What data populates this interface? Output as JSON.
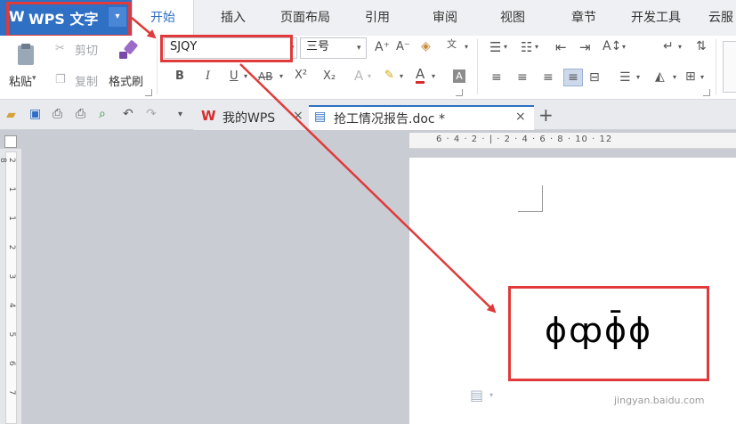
{
  "app": {
    "logo": "W",
    "title": "WPS 文字",
    "dropdown": "▾"
  },
  "tabs": [
    "开始",
    "插入",
    "页面布局",
    "引用",
    "审阅",
    "视图",
    "章节",
    "开发工具",
    "云服"
  ],
  "clipboard": {
    "paste": "粘贴",
    "cut": "剪切",
    "copy": "复制",
    "format_painter": "格式刷"
  },
  "font": {
    "name": "SJQY",
    "size": "三号"
  },
  "doc_tabs": [
    {
      "label": "我的WPS",
      "close": "×"
    },
    {
      "label": "抢工情况报告.doc *",
      "close": "×"
    }
  ],
  "new_tab": "+",
  "ruler_top_text": "6 · 4 · 2 · | · 2 · 4 · 6 · 8 · 10 · 12",
  "ruler_left_text": "2 1 1 2 3 4 5 6 7 8",
  "document": {
    "symbols": "ɸȹɸ̄ɸ"
  },
  "watermark": "jingyan.baidu.com",
  "colors": {
    "brand": "#2f6fc4",
    "highlight_box": "#e03a3a",
    "arrow": "#e03a3a"
  },
  "icons": [
    "paste-icon",
    "cut-icon",
    "copy-icon",
    "format-painter-icon",
    "bold-icon",
    "italic-icon",
    "underline-icon",
    "strikethrough-icon",
    "superscript-icon",
    "subscript-icon",
    "font-color-icon",
    "highlight-icon",
    "bullets-icon",
    "numbering-icon",
    "indent-icon",
    "outdent-icon",
    "align-left-icon",
    "align-center-icon",
    "align-right-icon",
    "justify-icon",
    "line-spacing-icon",
    "shading-icon",
    "border-icon",
    "open-icon",
    "save-icon",
    "print-icon",
    "undo-icon",
    "redo-icon"
  ]
}
